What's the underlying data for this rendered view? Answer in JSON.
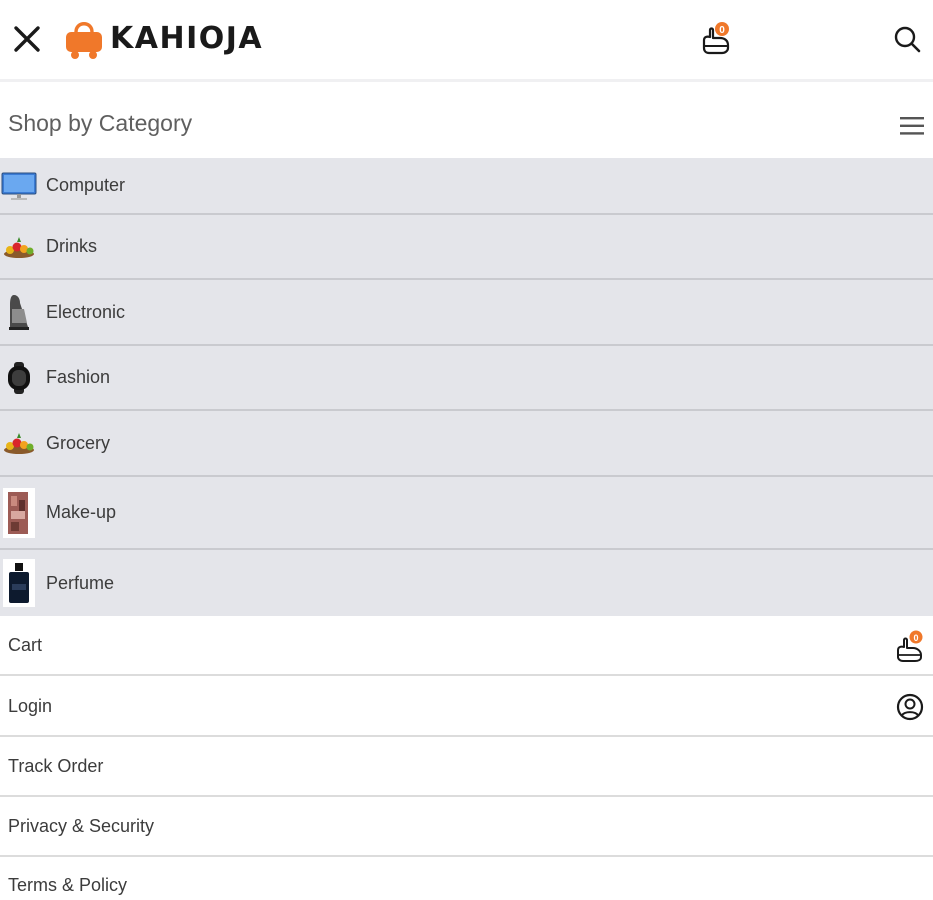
{
  "header": {
    "logo_text": "KAHIOJA",
    "cart_count": "0",
    "brand_color": "#f0782a"
  },
  "category": {
    "title": "Shop by Category",
    "items": [
      {
        "label": "Computer",
        "icon": "monitor-icon"
      },
      {
        "label": "Drinks",
        "icon": "fruit-basket-icon"
      },
      {
        "label": "Electronic",
        "icon": "clothes-iron-icon"
      },
      {
        "label": "Fashion",
        "icon": "smartwatch-icon"
      },
      {
        "label": "Grocery",
        "icon": "fruit-basket-icon"
      },
      {
        "label": "Make-up",
        "icon": "cosmetics-icon"
      },
      {
        "label": "Perfume",
        "icon": "perfume-bottle-icon"
      }
    ]
  },
  "menu": {
    "cart_label": "Cart",
    "cart_count": "0",
    "login_label": "Login",
    "track_label": "Track Order",
    "privacy_label": "Privacy & Security",
    "terms_label": "Terms & Policy"
  }
}
